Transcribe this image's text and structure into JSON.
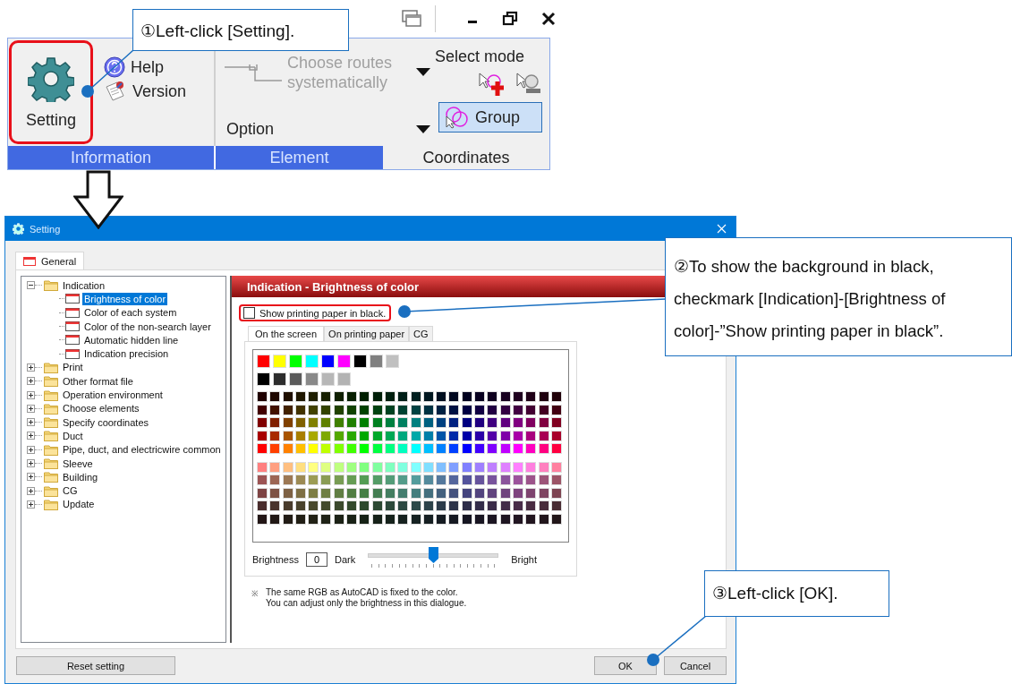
{
  "ribbon": {
    "setting_button": {
      "label": "Setting",
      "highlighted": true
    },
    "help": {
      "label": "Help"
    },
    "version": {
      "label": "Version"
    },
    "choose_routes": {
      "label": "Choose routes systematically",
      "disabled": true
    },
    "option": {
      "label": "Option"
    },
    "select_mode": {
      "label": "Select mode"
    },
    "group_button": {
      "label": "Group",
      "selected": true
    },
    "footer": [
      {
        "label": "Information",
        "active": true
      },
      {
        "label": "Element",
        "active": true
      },
      {
        "label": "Coordinates",
        "active": false
      }
    ]
  },
  "dialog": {
    "title": "Setting",
    "tabs": [
      {
        "label": "General",
        "selected": true
      }
    ],
    "tree": [
      {
        "label": "Indication",
        "expanded": true,
        "selected": false,
        "children": [
          {
            "label": "Brightness of color",
            "selected": true
          },
          {
            "label": "Color of each system",
            "selected": false
          },
          {
            "label": "Color of the non-search layer",
            "selected": false
          },
          {
            "label": "Automatic hidden line",
            "selected": false
          },
          {
            "label": "Indication precision",
            "selected": false
          }
        ]
      },
      {
        "label": "Print",
        "expanded": false,
        "selected": false
      },
      {
        "label": "Other format file",
        "expanded": false,
        "selected": false
      },
      {
        "label": "Operation environment",
        "expanded": false,
        "selected": false
      },
      {
        "label": "Choose elements",
        "expanded": false,
        "selected": false
      },
      {
        "label": "Specify coordinates",
        "expanded": false,
        "selected": false
      },
      {
        "label": "Duct",
        "expanded": false,
        "selected": false
      },
      {
        "label": "Pipe, duct, and electricwire common",
        "expanded": false,
        "selected": false
      },
      {
        "label": "Sleeve",
        "expanded": false,
        "selected": false
      },
      {
        "label": "Building",
        "expanded": false,
        "selected": false
      },
      {
        "label": "CG",
        "expanded": false,
        "selected": false
      },
      {
        "label": "Update",
        "expanded": false,
        "selected": false
      }
    ],
    "panel_header": "Indication - Brightness of color",
    "checkbox": {
      "label": "Show printing paper in black.",
      "checked": false,
      "highlighted": true
    },
    "subtabs": [
      {
        "label": "On the screen",
        "selected": true
      },
      {
        "label": "On printing paper",
        "selected": false
      },
      {
        "label": "CG",
        "selected": false
      }
    ],
    "basic_colors": [
      {
        "color": "#ff0000"
      },
      {
        "color": "#ffff00"
      },
      {
        "color": "#00ff00"
      },
      {
        "color": "#00ffff"
      },
      {
        "color": "#0000ff"
      },
      {
        "color": "#ff00ff"
      },
      {
        "color": "#000000"
      },
      {
        "color": "#808080"
      },
      {
        "color": "#c0c0c0"
      }
    ],
    "gray_colors": [
      {
        "color": "#000000"
      },
      {
        "color": "#2d2d2d"
      },
      {
        "color": "#5b5b5b"
      },
      {
        "color": "#898989"
      },
      {
        "color": "#b7b7b7"
      },
      {
        "color": "#b3b3b3"
      }
    ],
    "brightness": {
      "label": "Brightness",
      "value": "0",
      "low_label": "Dark",
      "high_label": "Bright",
      "level": 0.5
    },
    "note": {
      "mark": "※",
      "lines": [
        "The same RGB as AutoCAD is fixed to the color.",
        "You can adjust only the brightness in this dialogue."
      ]
    },
    "buttons": {
      "reset": "Reset setting",
      "ok": "OK",
      "cancel": "Cancel"
    }
  },
  "callouts": [
    "①Left-click [Setting].",
    "②To show the background in black, checkmark [Indication]-[Brightness of color]-”Show printing paper in black”.",
    "③Left-click [OK]."
  ]
}
